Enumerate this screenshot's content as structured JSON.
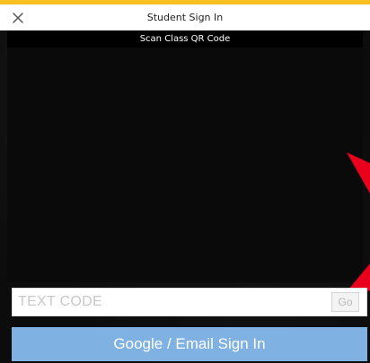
{
  "header": {
    "title": "Student Sign In",
    "close_icon": "close-icon"
  },
  "scanner": {
    "banner": "Scan Class QR Code"
  },
  "code_entry": {
    "placeholder": "TEXT CODE",
    "value": "",
    "go_label": "Go"
  },
  "signin": {
    "label": "Google / Email Sign In"
  },
  "colors": {
    "accent_bar": "#f7bf1f",
    "signin_button": "#7fb1e3",
    "annotation_arrow": "#e8001c"
  }
}
